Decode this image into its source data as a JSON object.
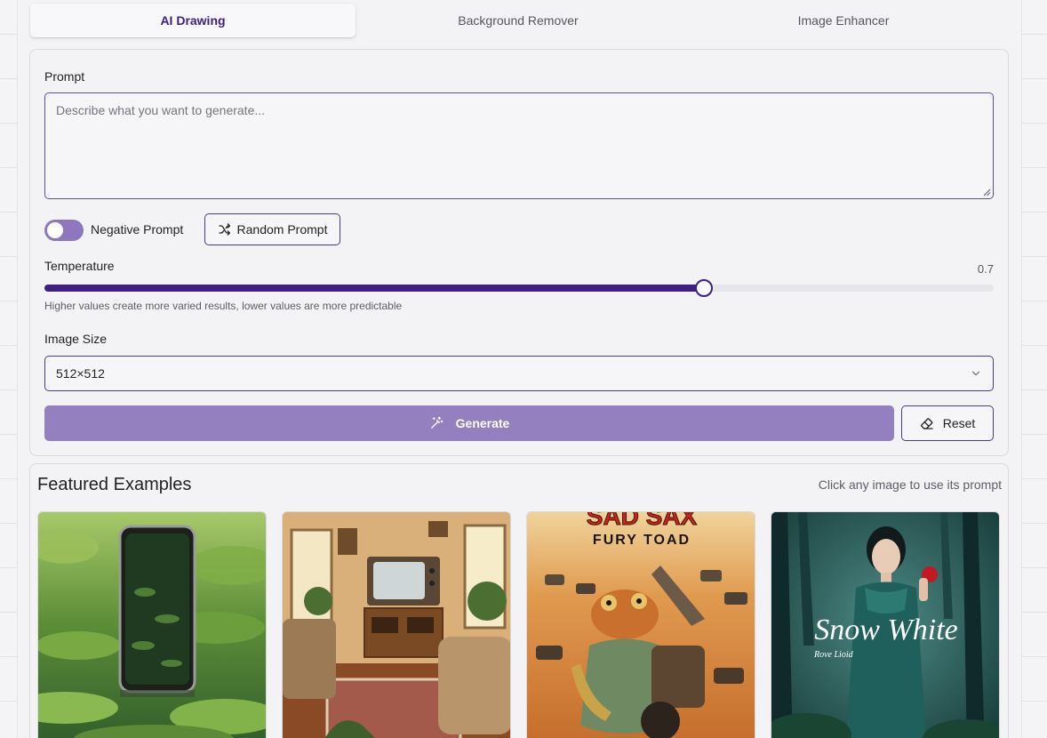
{
  "tabs": [
    {
      "label": "AI Drawing",
      "active": true
    },
    {
      "label": "Background Remover",
      "active": false
    },
    {
      "label": "Image Enhancer",
      "active": false
    }
  ],
  "prompt": {
    "label": "Prompt",
    "placeholder": "Describe what you want to generate...",
    "value": ""
  },
  "negative_prompt": {
    "label": "Negative Prompt",
    "enabled": false
  },
  "random_prompt": {
    "label": "Random Prompt",
    "icon": "shuffle-icon"
  },
  "temperature": {
    "label": "Temperature",
    "value": 0.7,
    "display": "0.7",
    "min": 0,
    "max": 1,
    "hint": "Higher values create more varied results, lower values are more predictable"
  },
  "image_size": {
    "label": "Image Size",
    "selected": "512×512"
  },
  "generate": {
    "label": "Generate",
    "icon": "magic-wand-icon"
  },
  "reset": {
    "label": "Reset",
    "icon": "eraser-icon"
  },
  "featured": {
    "title": "Featured Examples",
    "hint": "Click any image to use its prompt",
    "examples": [
      {
        "subject": "smartphone among lily pads"
      },
      {
        "subject": "retro living room with tv"
      },
      {
        "subject": "frog movie poster",
        "poster_title": "SAD SAX",
        "poster_subtitle": "FURY TOAD"
      },
      {
        "subject": "fantasy princess poster",
        "poster_title": "Snow White",
        "poster_subtitle": "Rove Lioid"
      }
    ]
  },
  "colors": {
    "accent": "#3f1f84",
    "generate_bg": "#9480be",
    "toggle_bg": "#8e77bd"
  }
}
